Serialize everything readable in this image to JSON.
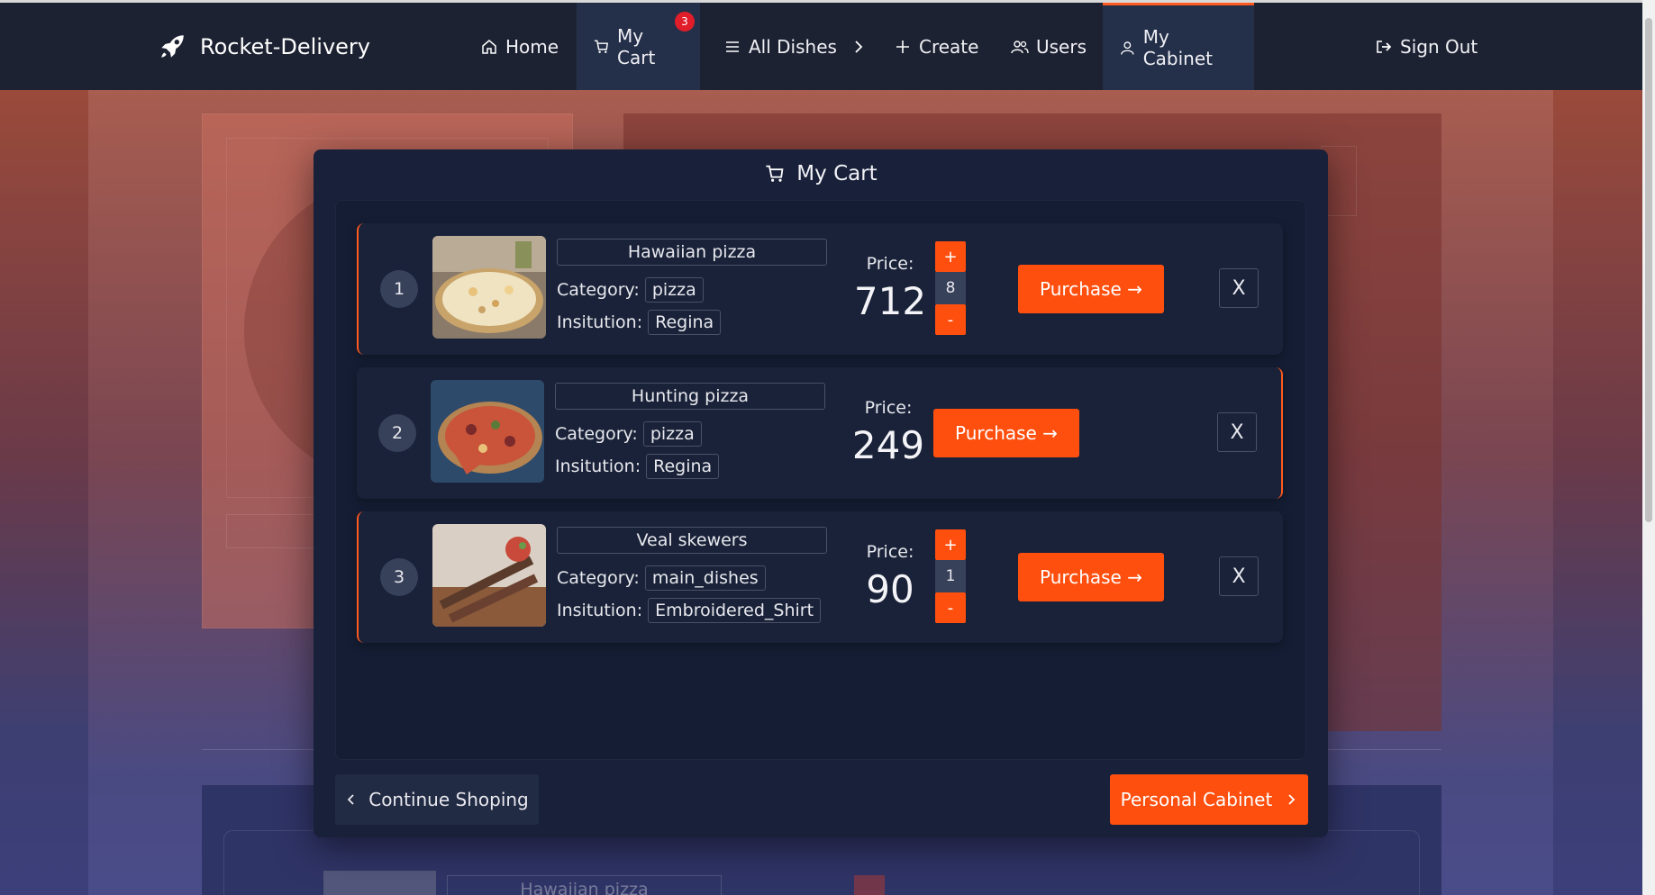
{
  "brand": {
    "name": "Rocket-Delivery",
    "icon": "rocket-icon"
  },
  "nav": {
    "home": "Home",
    "cart": "My Cart",
    "cart_badge": "3",
    "all_dishes": "All Dishes",
    "create": "Create",
    "users": "Users",
    "cabinet": "My Cabinet",
    "sign_out": "Sign Out"
  },
  "background": {
    "dish_name": "Hawaiian pizza"
  },
  "modal": {
    "title": "My Cart",
    "continue_label": "Continue Shoping",
    "cabinet_label": "Personal Cabinet"
  },
  "labels": {
    "category": "Category:",
    "institution": "Insitution:",
    "price": "Price:",
    "purchase": "Purchase →",
    "remove": "X",
    "plus": "+",
    "minus": "-"
  },
  "items": [
    {
      "num": "1",
      "name": "Hawaiian pizza",
      "category": "pizza",
      "institution": "Regina",
      "price": "712",
      "qty": "8",
      "has_stepper": true,
      "image": "pizza-photo"
    },
    {
      "num": "2",
      "name": "Hunting pizza",
      "category": "pizza",
      "institution": "Regina",
      "price": "249",
      "has_stepper": false,
      "image": "pizza-photo"
    },
    {
      "num": "3",
      "name": "Veal skewers",
      "category": "main_dishes",
      "institution": "Embroidered_Shirt",
      "price": "90",
      "qty": "1",
      "has_stepper": true,
      "image": "skewers-photo"
    }
  ],
  "colors": {
    "accent": "#ff4f0f",
    "navbar": "#1d2232",
    "modal": "#18203a",
    "badge": "#e11d2a"
  }
}
